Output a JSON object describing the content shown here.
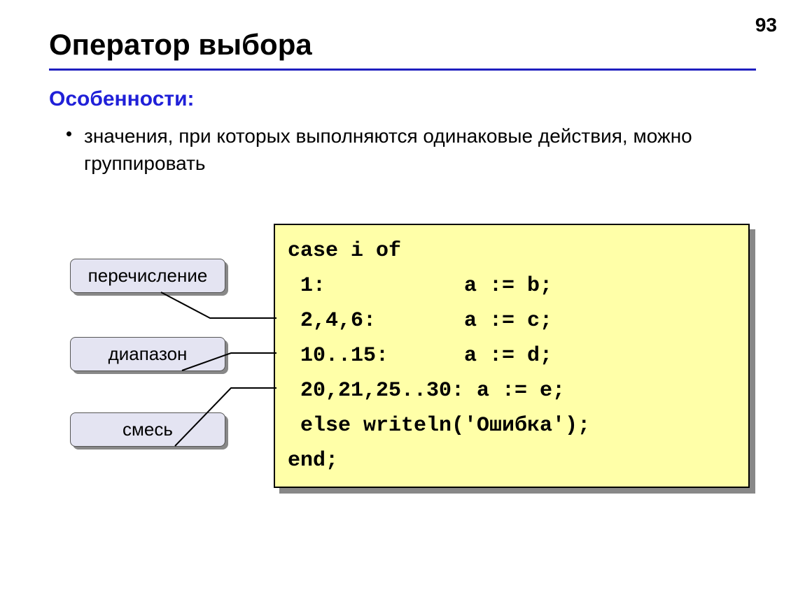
{
  "page_number": "93",
  "title": "Оператор выбора",
  "subheading": "Особенности:",
  "bullet": "значения, при которых выполняются одинаковые действия, можно группировать",
  "callouts": {
    "enum": "перечисление",
    "range": "диапазон",
    "mix": "смесь"
  },
  "code": {
    "l1": "case i of",
    "l2": " 1:           a := b;",
    "l3": " 2,4,6:       a := c;",
    "l4": " 10..15:      a := d;",
    "l5": " 20,21,25..30: a := e;",
    "l6": " else writeln('Ошибка');",
    "l7": "end;"
  }
}
